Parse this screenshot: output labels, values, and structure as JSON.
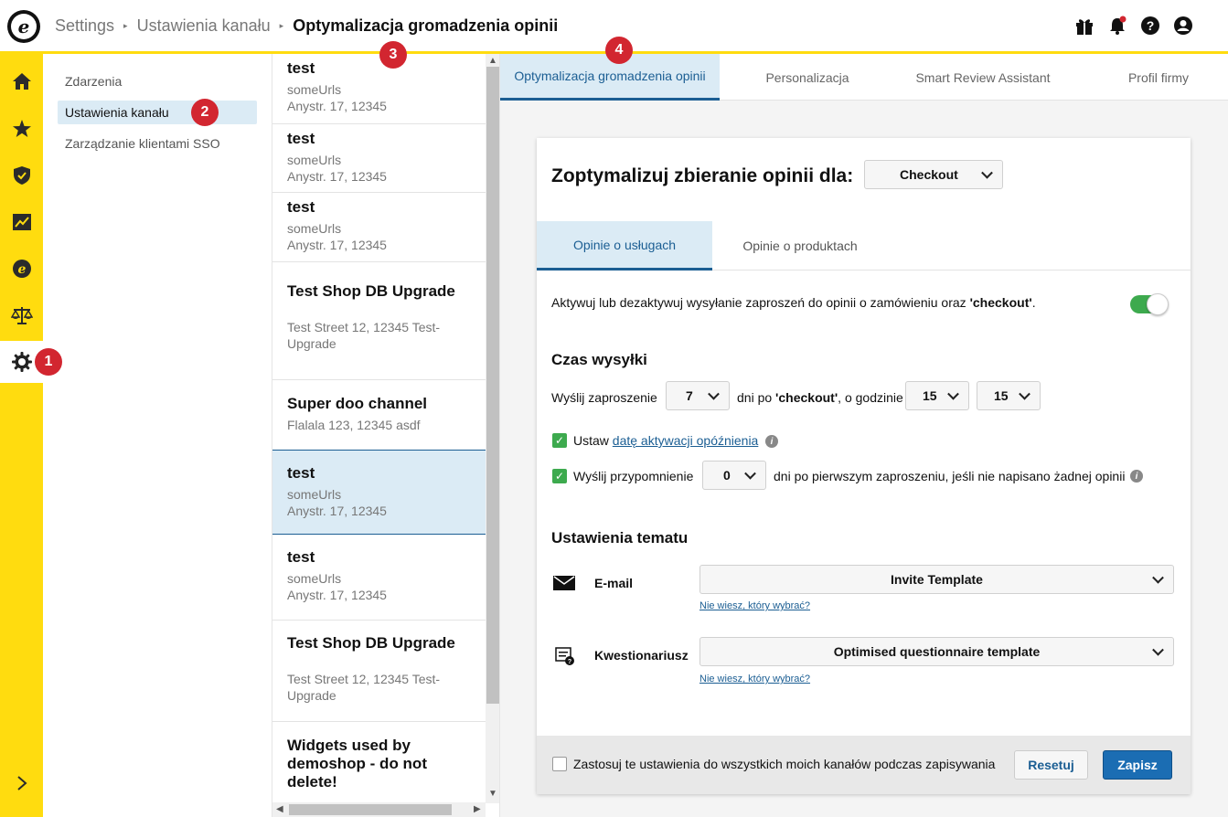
{
  "logo": {
    "glyph": "e"
  },
  "breadcrumb": {
    "items": [
      "Settings",
      "Ustawienia kanału"
    ],
    "current": "Optymalizacja gromadzenia opinii",
    "separator": "▸"
  },
  "top_icons": [
    "gift-icon",
    "bell-icon",
    "help-icon",
    "user-icon"
  ],
  "rail": {
    "items": [
      "home-icon",
      "star-icon",
      "shield-icon",
      "chart-icon",
      "trustmark-icon",
      "scales-icon",
      "gear-icon"
    ],
    "active": "gear-icon",
    "expand": "chevron-right-icon"
  },
  "nav": {
    "items": [
      {
        "label": "Zdarzenia"
      },
      {
        "label": "Ustawienia kanału"
      },
      {
        "label": "Zarządzanie klientami SSO"
      }
    ]
  },
  "channels": [
    {
      "name": "test",
      "sub1": "someUrls",
      "sub2": "Anystr. 17, 12345"
    },
    {
      "name": "test",
      "sub1": "someUrls",
      "sub2": "Anystr. 17, 12345"
    },
    {
      "name": "test",
      "sub1": "someUrls",
      "sub2": "Anystr. 17, 12345"
    },
    {
      "name": "Test Shop DB Upgrade",
      "sub1": "Test Street 12, 12345 Test-",
      "sub2": "Upgrade"
    },
    {
      "name": "Super doo channel",
      "sub1": "Flalala 123, 12345 asdf",
      "sub2": ""
    },
    {
      "name": "test",
      "sub1": "someUrls",
      "sub2": "Anystr. 17, 12345"
    },
    {
      "name": "test",
      "sub1": "someUrls",
      "sub2": "Anystr. 17, 12345"
    },
    {
      "name": "Test Shop DB Upgrade",
      "sub1": "Test Street 12, 12345 Test-",
      "sub2": "Upgrade"
    },
    {
      "name1": "Widgets used by",
      "name2": "demoshop - do not",
      "name3": "delete!"
    }
  ],
  "main_tabs": [
    "Optymalizacja gromadzenia opinii",
    "Personalizacja",
    "Smart Review Assistant",
    "Profil firmy"
  ],
  "card": {
    "title": "Zoptymalizuj zbieranie opinii dla:",
    "event_select": "Checkout",
    "subtabs": [
      "Opinie o usługach",
      "Opinie o produktach"
    ],
    "activate_text_a": "Aktywuj lub dezaktywuj wysyłanie zaproszeń do opinii o zamówieniu oraz ",
    "activate_text_b": "'checkout'",
    "activate_text_c": ".",
    "toggle_on": true,
    "send_time_heading": "Czas wysyłki",
    "send_invite_label": "Wyślij zaproszenie",
    "days_value": "7",
    "days_after_a": "dni po ",
    "days_after_b": "'checkout'",
    "days_after_c": ", o godzinie",
    "hour_value": "15",
    "minute_value": "15",
    "delay_label_a": "Ustaw ",
    "delay_link": "datę aktywacji opóźnienia",
    "reminder_label": "Wyślij przypomnienie",
    "reminder_value": "0",
    "reminder_after": "dni po pierwszym zaproszeniu, jeśli nie napisano żadnej opinii",
    "theme_heading": "Ustawienia tematu",
    "email_label": "E-mail",
    "email_template": "Invite Template",
    "help_link": "Nie wiesz, który wybrać?",
    "questionnaire_label": "Kwestionariusz",
    "questionnaire_template": "Optimised questionnaire template",
    "apply_all_label": "Zastosuj te ustawienia do wszystkich moich kanałów podczas zapisywania",
    "reset_label": "Resetuj",
    "save_label": "Zapisz"
  },
  "badges": [
    "1",
    "2",
    "3",
    "4"
  ],
  "colors": {
    "accent_yellow": "#ffdc0f",
    "primary_blue": "#1b6db3",
    "active_tab_bg": "#dbebf5",
    "toggle_green": "#3daa4e",
    "badge_red": "#d22630"
  }
}
